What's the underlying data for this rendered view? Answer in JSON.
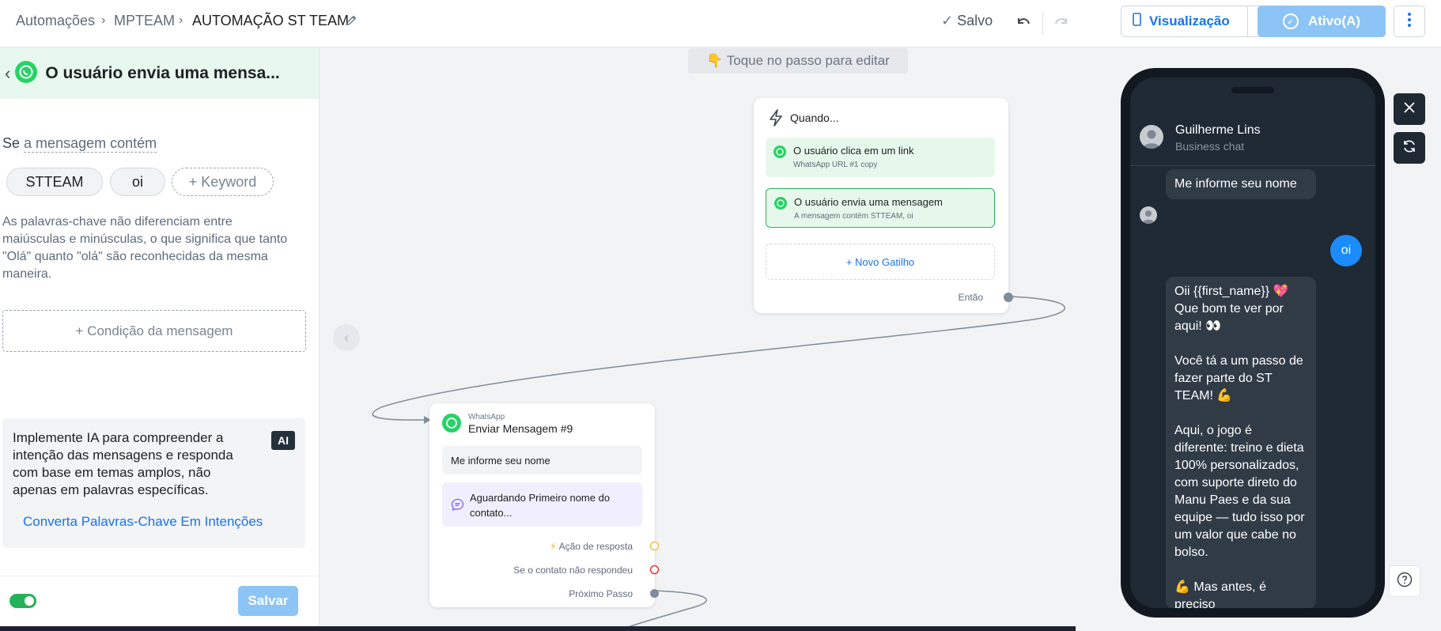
{
  "breadcrumb": {
    "root": "Automações",
    "team": "MPTEAM",
    "current": "AUTOMAÇÃO ST TEAM"
  },
  "toolbar": {
    "saved_label": "Salvo",
    "view_label": "Visualização",
    "active_label": "Ativo(A)"
  },
  "colors": {
    "brand_blue": "#1a73e8",
    "active_disabled": "#8cc4f5",
    "whatsapp_green": "#25d366",
    "trigger_bg": "#e6f8ec",
    "phone_bg": "#1f2933"
  },
  "left_panel": {
    "title": "O usuário envia uma mensa...",
    "condition_prefix": "Se",
    "condition": "a mensagem contém",
    "keywords": [
      "STTEAM",
      "oi"
    ],
    "add_keyword": "+ Keyword",
    "hint": "As palavras-chave não diferenciam entre maiúsculas e minúsculas, o que significa que tanto \"Olá\" quanto \"olá\" são reconhecidas da mesma maneira.",
    "add_condition": "+ Condição da mensagem",
    "ai_text": "Implemente IA para compreender a intenção das mensagens e responda com base em temas amplos, não apenas em palavras específicas.",
    "ai_badge": "AI",
    "ai_link": "Converta Palavras-Chave Em Intenções",
    "save_label": "Salvar"
  },
  "canvas": {
    "tap_hint": "👇 Toque no passo para editar",
    "trigger_card": {
      "title": "Quando...",
      "triggers": [
        {
          "title": "O usuário clica em um link",
          "sub": "WhatsApp URL #1 copy"
        },
        {
          "title": "O usuário envia uma mensagem",
          "sub": "A mensagem contém STTEAM, oi"
        }
      ],
      "new_trigger": "+ Novo Gatilho",
      "then_label": "Então"
    },
    "message_card": {
      "channel": "WhatsApp",
      "title": "Enviar Mensagem #9",
      "message": "Me informe seu nome",
      "waiting": "Aguardando Primeiro nome do contato...",
      "reply_action": "Ação de resposta",
      "no_reply": "Se o contato não respondeu",
      "next_step": "Próximo Passo"
    }
  },
  "preview": {
    "contact_name": "Guilherme Lins",
    "contact_sub": "Business chat",
    "msg_in_1": "Me informe seu nome",
    "msg_out_1": "oi",
    "msg_in_2": "Oii {{first_name}} 💖 Que bom te ver por aqui! 👀\n\nVocê tá a um passo de fazer parte do ST TEAM! 💪\n\nAqui, o jogo é diferente: treino e dieta 100% personalizados, com suporte direto do Manu Paes e da sua equipe — tudo isso por um valor que cabe no bolso.\n\n💪 Mas antes, é preciso"
  }
}
